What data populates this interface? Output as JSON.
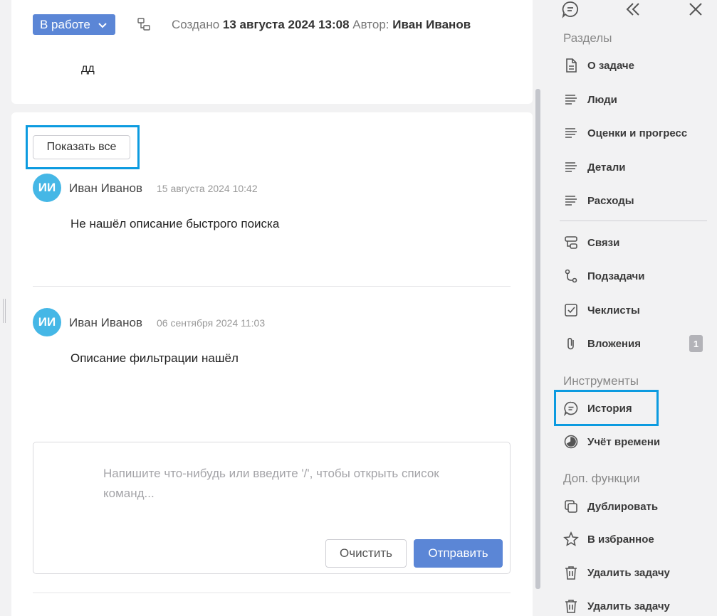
{
  "header": {
    "status_label": "В работе",
    "created_prefix": "Создано",
    "created_date": "13 августа 2024 13:08",
    "author_prefix": "Автор:",
    "author_name": "Иван Иванов"
  },
  "task": {
    "description": "дд"
  },
  "history": {
    "show_all_label": "Показать все",
    "comments": [
      {
        "initials": "ИИ",
        "author": "Иван Иванов",
        "date": "15 августа 2024 10:42",
        "text": "Не нашёл описание быстрого поиска"
      },
      {
        "initials": "ИИ",
        "author": "Иван Иванов",
        "date": "06 сентября 2024 11:03",
        "text": "Описание фильтрации нашёл"
      }
    ]
  },
  "editor": {
    "placeholder": "Напишите что-нибудь или введите '/', чтобы открыть список команд...",
    "clear_label": "Очистить",
    "send_label": "Отправить"
  },
  "sidebar": {
    "sections_title": "Разделы",
    "sections": [
      {
        "label": "О задаче",
        "icon": "document-icon"
      },
      {
        "label": "Люди",
        "icon": "lines-icon"
      },
      {
        "label": "Оценки и прогресс",
        "icon": "lines-icon"
      },
      {
        "label": "Детали",
        "icon": "lines-icon"
      },
      {
        "label": "Расходы",
        "icon": "lines-icon"
      },
      {
        "label": "Связи",
        "icon": "links-icon"
      },
      {
        "label": "Подзадачи",
        "icon": "subtasks-icon"
      },
      {
        "label": "Чеклисты",
        "icon": "checkbox-icon"
      },
      {
        "label": "Вложения",
        "icon": "paperclip-icon",
        "badge": "1"
      }
    ],
    "tools_title": "Инструменты",
    "tools": [
      {
        "label": "История",
        "icon": "chat-icon"
      },
      {
        "label": "Учёт времени",
        "icon": "clock-pie-icon"
      }
    ],
    "extra_title": "Доп. функции",
    "extra": [
      {
        "label": "Дублировать",
        "icon": "copy-icon"
      },
      {
        "label": "В избранное",
        "icon": "star-icon"
      },
      {
        "label": "Удалить задачу",
        "icon": "trash-icon"
      },
      {
        "label": "Удалить задачу",
        "icon": "trash-icon"
      }
    ]
  },
  "colors": {
    "accent": "#5b86d6",
    "avatar": "#45b7e6",
    "highlight": "#0c9be0"
  }
}
